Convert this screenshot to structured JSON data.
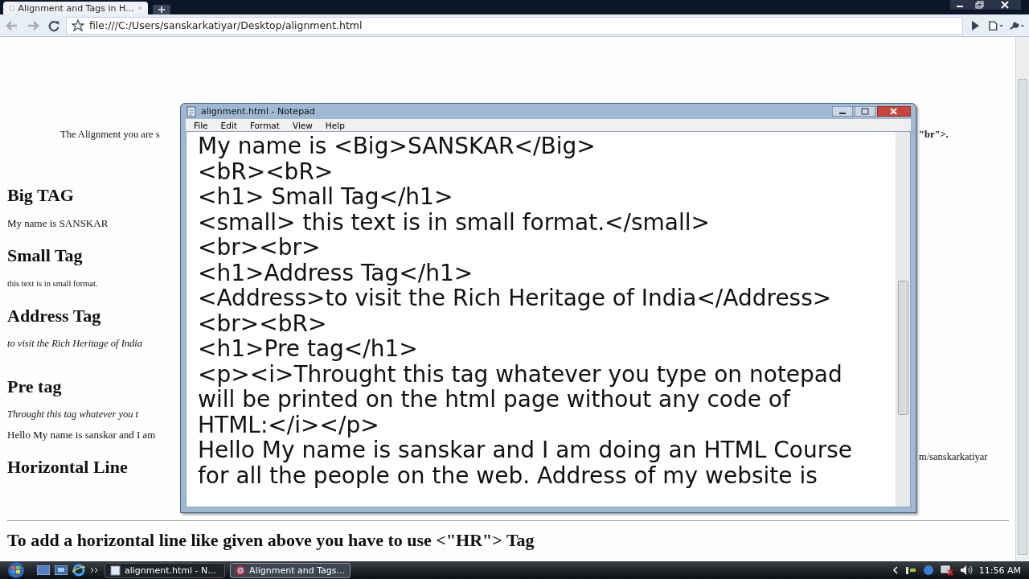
{
  "browser": {
    "tabs": [
      {
        "title": "Alignment and Tags in H...",
        "selected": true
      }
    ],
    "address": "file:///C:/Users/sanskarkatiyar/Desktop/alignment.html"
  },
  "page": {
    "left": [
      {
        "kind": "para",
        "text": "The Alignment you are s"
      },
      {
        "kind": "heading",
        "text": "Big TAG"
      },
      {
        "kind": "text",
        "text": "My name is SANSKAR"
      },
      {
        "kind": "heading",
        "text": "Small Tag"
      },
      {
        "kind": "small",
        "text": "this text is in small format."
      },
      {
        "kind": "heading",
        "text": "Address Tag"
      },
      {
        "kind": "italic",
        "text": "to visit the Rich Heritage of India"
      },
      {
        "kind": "heading",
        "text": "Pre tag"
      },
      {
        "kind": "italic",
        "text": "Throught this tag whatever you t"
      },
      {
        "kind": "text",
        "text": "Hello My name is sanskar and I am"
      },
      {
        "kind": "heading",
        "text": "Horizontal Line"
      }
    ],
    "right": [
      "\"br\">.",
      "m/sanskarkatiyar"
    ],
    "bottom_heading": "To add a horizontal line like given above you have to use <\"HR\"> Tag"
  },
  "notepad": {
    "title": "alignment.html - Notepad",
    "menu": [
      "File",
      "Edit",
      "Format",
      "View",
      "Help"
    ],
    "lines": [
      "My name is <Big>SANSKAR</Big>",
      "<bR><bR>",
      "<h1> Small Tag</h1>",
      "<small> this text is in small format.</small>",
      "<br><br>",
      "<h1>Address Tag</h1>",
      "<Address>to visit the Rich Heritage of India</Address>",
      "<br><bR>",
      "<h1>Pre tag</h1>",
      "<p><i>Throught this tag whatever you type on notepad",
      "will be printed on the html page without any code of",
      "HTML:</i></p>",
      "Hello My name is sanskar and I am doing an HTML Course",
      "for all the people on the web. Address of my website is"
    ]
  },
  "taskbar": {
    "tasks": [
      {
        "label": "alignment.html - N...",
        "kind": "notepad",
        "selected": false
      },
      {
        "label": "Alignment and Tags...",
        "kind": "browser",
        "selected": true
      }
    ],
    "clock": "11:56 AM"
  }
}
